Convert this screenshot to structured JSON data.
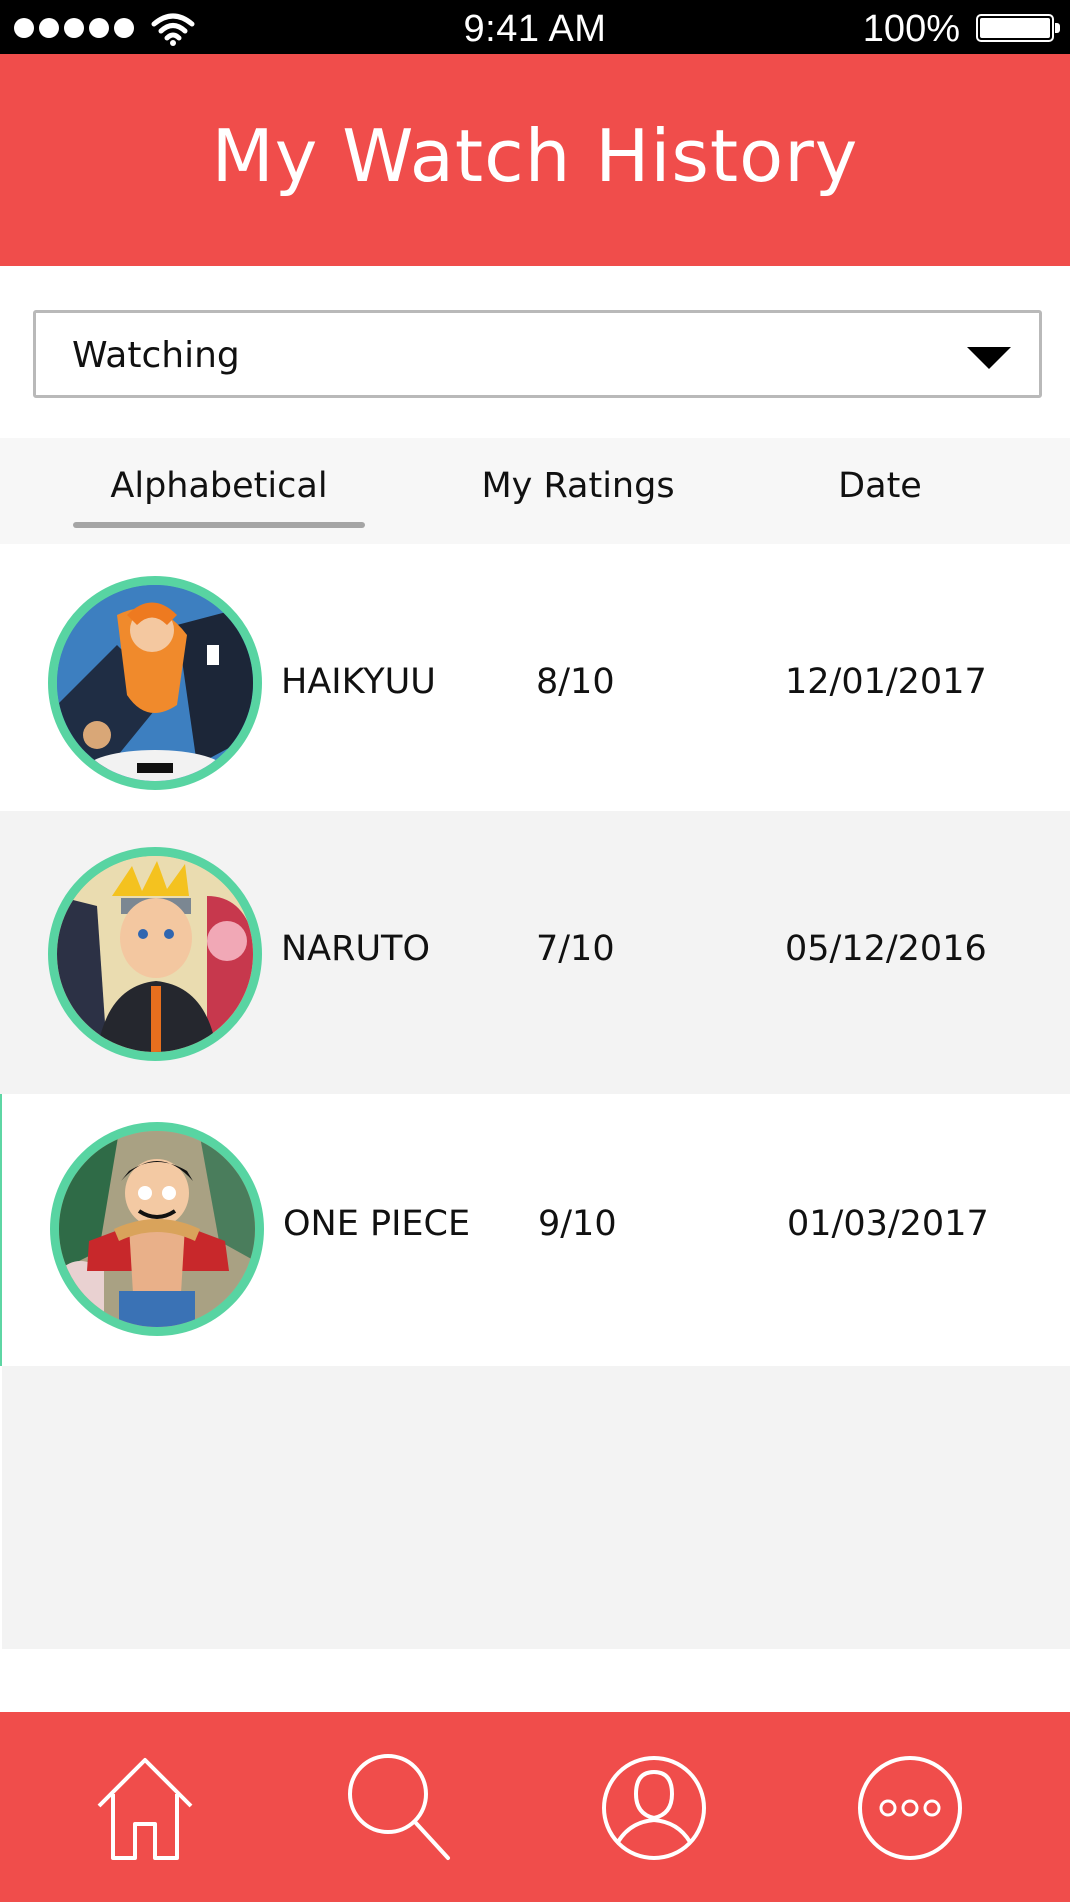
{
  "status_bar": {
    "time": "9:41 AM",
    "battery": "100%"
  },
  "header": {
    "title": "My Watch History"
  },
  "filter": {
    "selected": "Watching"
  },
  "sort_tabs": [
    {
      "label": "Alphabetical",
      "active": true
    },
    {
      "label": "My Ratings",
      "active": false
    },
    {
      "label": "Date",
      "active": false
    }
  ],
  "history": [
    {
      "title": "HAIKYUU",
      "rating": "8/10",
      "date": "12/01/2017"
    },
    {
      "title": "NARUTO",
      "rating": "7/10",
      "date": "05/12/2016"
    },
    {
      "title": "ONE PIECE",
      "rating": "9/10",
      "date": "01/03/2017"
    }
  ],
  "nav": {
    "icons": [
      "home-icon",
      "search-icon",
      "profile-icon",
      "more-icon"
    ]
  },
  "colors": {
    "brand": "#f04d4b",
    "avatar_ring": "#58d4a2",
    "tab_underline": "#a5a5a5",
    "row_alt": "#f3f3f3"
  }
}
